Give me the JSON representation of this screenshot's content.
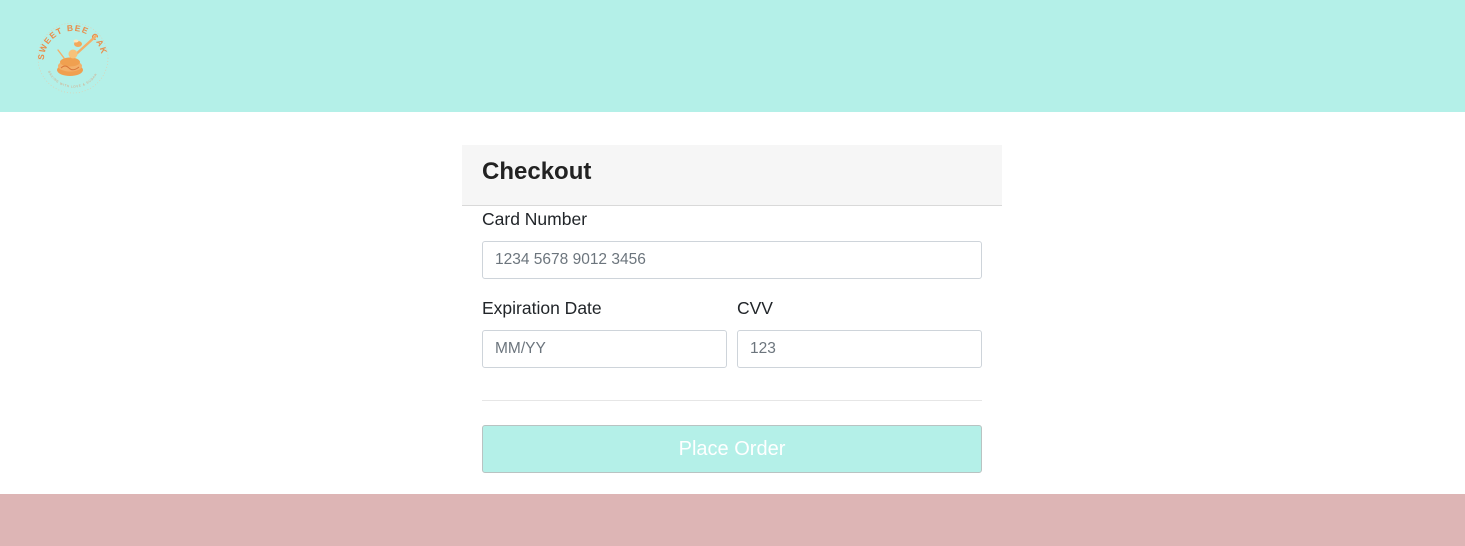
{
  "logo": {
    "brand_text": "SWEET BEE CAKES",
    "tagline": "BAKING WITH LOVE & SUGAR"
  },
  "checkout": {
    "title": "Checkout",
    "card_number": {
      "label": "Card Number",
      "placeholder": "1234 5678 9012 3456",
      "value": ""
    },
    "expiration": {
      "label": "Expiration Date",
      "placeholder": "MM/YY",
      "value": ""
    },
    "cvv": {
      "label": "CVV",
      "placeholder": "123",
      "value": ""
    },
    "submit_label": "Place Order"
  },
  "colors": {
    "header_bg": "#b4f0e8",
    "footer_bg": "#ddb5b5",
    "button_bg": "#b4f0e8",
    "logo_orange": "#f0a050"
  }
}
